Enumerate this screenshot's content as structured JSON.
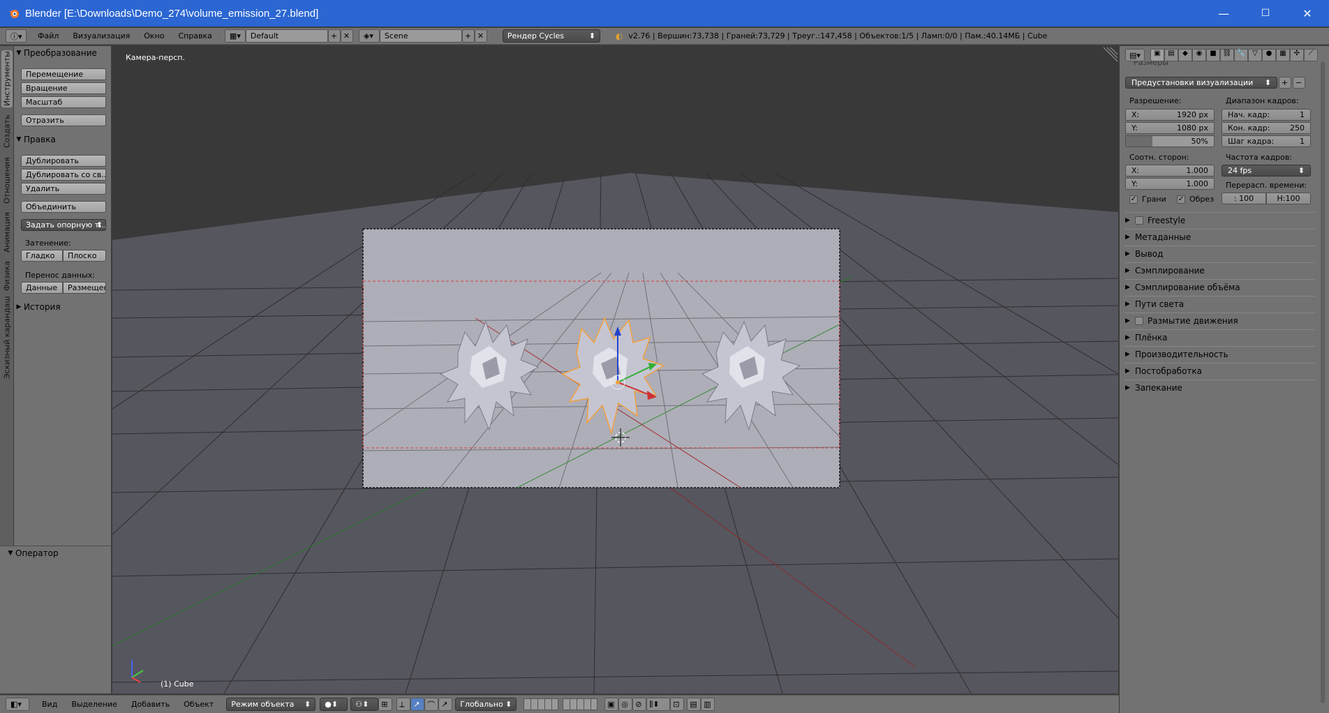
{
  "window": {
    "title": "Blender [E:\\Downloads\\Demo_274\\volume_emission_27.blend]",
    "minimize": "—",
    "maximize": "☐",
    "close": "✕"
  },
  "infobar": {
    "menus": [
      "Файл",
      "Визуализация",
      "Окно",
      "Справка"
    ],
    "screen_layout": "Default",
    "scene": "Scene",
    "render_engine": "Рендер Cycles",
    "stats": "v2.76 | Вершин:73,738 | Граней:73,729 | Треуг.:147,458 | Объектов:1/5 | Ламп:0/0 | Пам.:40.14МБ | Cube"
  },
  "tool_tabs": [
    "Инструменты",
    "Создать",
    "Отношения",
    "Анимация",
    "Физика",
    "Эскизный карандаш"
  ],
  "tool_shelf": {
    "transform_header": "Преобразование",
    "move": "Перемещение",
    "rotate": "Вращение",
    "scale": "Масштаб",
    "mirror": "Отразить",
    "edit_header": "Правка",
    "duplicate": "Дублировать",
    "duplicate_linked": "Дублировать со св...",
    "delete": "Удалить",
    "join": "Объединить",
    "set_origin": "Задать опорную т...",
    "shading_label": "Затенение:",
    "smooth": "Гладко",
    "flat": "Плоско",
    "data_transfer_label": "Перенос данных:",
    "data": "Данные",
    "layout": "Размещен",
    "history_header": "История"
  },
  "operator_panel": {
    "header": "Оператор"
  },
  "viewport": {
    "view_label": "Камера-персп.",
    "object_label": "(1) Cube"
  },
  "bottombar": {
    "menus": [
      "Вид",
      "Выделение",
      "Добавить",
      "Объект"
    ],
    "mode": "Режим объекта",
    "orientation": "Глобально"
  },
  "properties": {
    "cut_header": "Размеры",
    "presets": "Предустановки визуализации",
    "resolution_label": "Разрешение:",
    "res_x": "X:",
    "res_x_val": "1920 px",
    "res_y": "Y:",
    "res_y_val": "1080 px",
    "res_pct": "50%",
    "frame_range_label": "Диапазон кадров:",
    "frame_start": "Нач. кадр:",
    "frame_start_val": "1",
    "frame_end": "Кон. кадр:",
    "frame_end_val": "250",
    "frame_step": "Шаг кадра:",
    "frame_step_val": "1",
    "aspect_label": "Соотн. сторон:",
    "asp_x": "X:",
    "asp_x_val": "1.000",
    "asp_y": "Y:",
    "asp_y_val": "1.000",
    "fps_label": "Частота кадров:",
    "fps": "24 fps",
    "remap_label": "Перерасп. времени:",
    "remap_old": ": 100",
    "remap_new": "Н:100",
    "border": "Грани",
    "crop": "Обрез",
    "sections": [
      "Freestyle",
      "Метаданные",
      "Вывод",
      "Сэмплирование",
      "Сэмплирование объёма",
      "Пути света",
      "Размытие движения",
      "Плёнка",
      "Производительность",
      "Постобработка",
      "Запекание"
    ]
  },
  "colors": {
    "titlebar": "#2b66d2",
    "panel": "#727272",
    "viewport_bg": "#393939",
    "camera_bg": "#aeaeb8",
    "selection": "#f0a040"
  }
}
